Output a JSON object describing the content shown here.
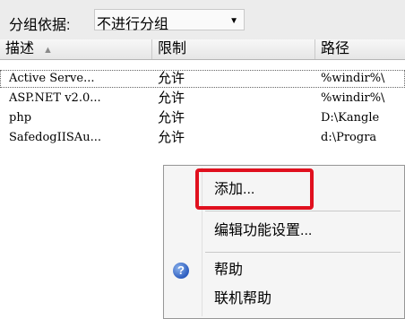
{
  "toolbar": {
    "group_by_label": "分组依据:",
    "group_by_value": "不进行分组"
  },
  "columns": [
    "描述",
    "限制",
    "路径"
  ],
  "rows": [
    {
      "description": "Active Serve...",
      "permission": "允许",
      "path": "%windir%\\"
    },
    {
      "description": "ASP.NET v2.0...",
      "permission": "允许",
      "path": "%windir%\\"
    },
    {
      "description": "php",
      "permission": "允许",
      "path": "D:\\Kangle"
    },
    {
      "description": "SafedogIISAu...",
      "permission": "允许",
      "path": "d:\\Progra"
    }
  ],
  "context_menu": {
    "items": [
      {
        "label": "添加..."
      },
      {
        "label": "编辑功能设置..."
      },
      {
        "label": "帮助",
        "icon": "help-icon"
      },
      {
        "label": "联机帮助"
      }
    ]
  },
  "colors": {
    "highlight": "#e0101e",
    "help_icon": "#2d5dbf"
  }
}
